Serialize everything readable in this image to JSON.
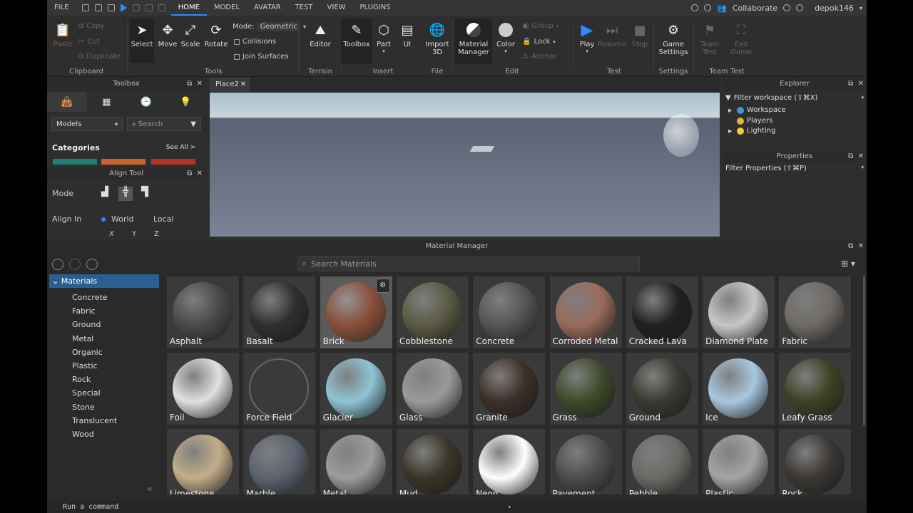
{
  "menu": {
    "file": "FILE",
    "tabs": [
      "HOME",
      "MODEL",
      "AVATAR",
      "TEST",
      "VIEW",
      "PLUGINS"
    ],
    "collaborate": "Collaborate",
    "user": "depok146"
  },
  "ribbon": {
    "clipboard": {
      "label": "Clipboard",
      "paste": "Paste",
      "copy": "Copy",
      "cut": "Cut",
      "duplicate": "Duplicate"
    },
    "tools": {
      "label": "Tools",
      "select": "Select",
      "move": "Move",
      "scale": "Scale",
      "rotate": "Rotate",
      "mode_label": "Mode:",
      "mode_value": "Geometric",
      "collisions": "Collisions",
      "join_surfaces": "Join Surfaces"
    },
    "terrain": {
      "label": "Terrain",
      "editor": "Editor"
    },
    "insert": {
      "label": "Insert",
      "toolbox": "Toolbox",
      "part": "Part",
      "ui": "UI"
    },
    "file": {
      "label": "File",
      "import3d_1": "Import",
      "import3d_2": "3D"
    },
    "edit": {
      "label": "Edit",
      "matmgr_1": "Material",
      "matmgr_2": "Manager",
      "color": "Color",
      "group": "Group",
      "lock": "Lock",
      "anchor": "Anchor"
    },
    "test": {
      "label": "Test",
      "play": "Play",
      "resume": "Resume",
      "stop": "Stop"
    },
    "settings": {
      "label": "Settings",
      "game_1": "Game",
      "game_2": "Settings"
    },
    "teamtest": {
      "label": "Team Test",
      "team_1": "Team",
      "team_2": "Test",
      "exit_1": "Exit",
      "exit_2": "Game"
    }
  },
  "toolbox": {
    "title": "Toolbox",
    "dropdown": "Models",
    "search_placeholder": "Search",
    "categories": "Categories",
    "see_all": "See All >",
    "category_colors": [
      "#1f7d74",
      "#c8632d",
      "#b8322a"
    ]
  },
  "aligntool": {
    "title": "Align Tool",
    "mode": "Mode",
    "align_in": "Align In",
    "world": "World",
    "local": "Local",
    "axes": [
      "X",
      "Y",
      "Z"
    ]
  },
  "viewport": {
    "tab": "Place2"
  },
  "explorer": {
    "title": "Explorer",
    "filter": "Filter workspace (⇧⌘X)",
    "items": [
      "Workspace",
      "Players",
      "Lighting"
    ]
  },
  "properties": {
    "title": "Properties",
    "filter": "Filter Properties (⇧⌘P)"
  },
  "material_manager": {
    "title": "Material Manager",
    "search_placeholder": "Search Materials",
    "root": "Materials",
    "categories": [
      "Concrete",
      "Fabric",
      "Ground",
      "Metal",
      "Organic",
      "Plastic",
      "Rock",
      "Special",
      "Stone",
      "Translucent",
      "Wood"
    ],
    "materials": [
      {
        "name": "Asphalt",
        "color": "#4a4a4a"
      },
      {
        "name": "Basalt",
        "color": "#2f2f2f"
      },
      {
        "name": "Brick",
        "color": "#8a4e38",
        "selected": true
      },
      {
        "name": "Cobblestone",
        "color": "#5a5a44"
      },
      {
        "name": "Concrete",
        "color": "#555555"
      },
      {
        "name": "Corroded Metal",
        "color": "#9a6a5a"
      },
      {
        "name": "Cracked Lava",
        "color": "#202020"
      },
      {
        "name": "Diamond Plate",
        "color": "#c7c7c7"
      },
      {
        "name": "Fabric",
        "color": "#6e6a66"
      },
      {
        "name": "Foil",
        "color": "#e0e0e0"
      },
      {
        "name": "Force Field",
        "color": "transparent"
      },
      {
        "name": "Glacier",
        "color": "#8ec4d6"
      },
      {
        "name": "Glass",
        "color": "#9a9a9a"
      },
      {
        "name": "Granite",
        "color": "#3d2f28"
      },
      {
        "name": "Grass",
        "color": "#3d4a2a"
      },
      {
        "name": "Ground",
        "color": "#3a3a32"
      },
      {
        "name": "Ice",
        "color": "#a8c8e0"
      },
      {
        "name": "Leafy Grass",
        "color": "#3e4224"
      },
      {
        "name": "Limestone",
        "color": "#c4ae88"
      },
      {
        "name": "Marble",
        "color": "#5c6370"
      },
      {
        "name": "Metal",
        "color": "#9c9c9c"
      },
      {
        "name": "Mud",
        "color": "#3a3528"
      },
      {
        "name": "Neon",
        "color": "#ffffff"
      },
      {
        "name": "Pavement",
        "color": "#4c4c4c"
      },
      {
        "name": "Pebble",
        "color": "#6a6a66"
      },
      {
        "name": "Plastic",
        "color": "#a4a4a4"
      },
      {
        "name": "Rock",
        "color": "#3a3734"
      }
    ]
  },
  "command": {
    "placeholder": "Run a command"
  }
}
